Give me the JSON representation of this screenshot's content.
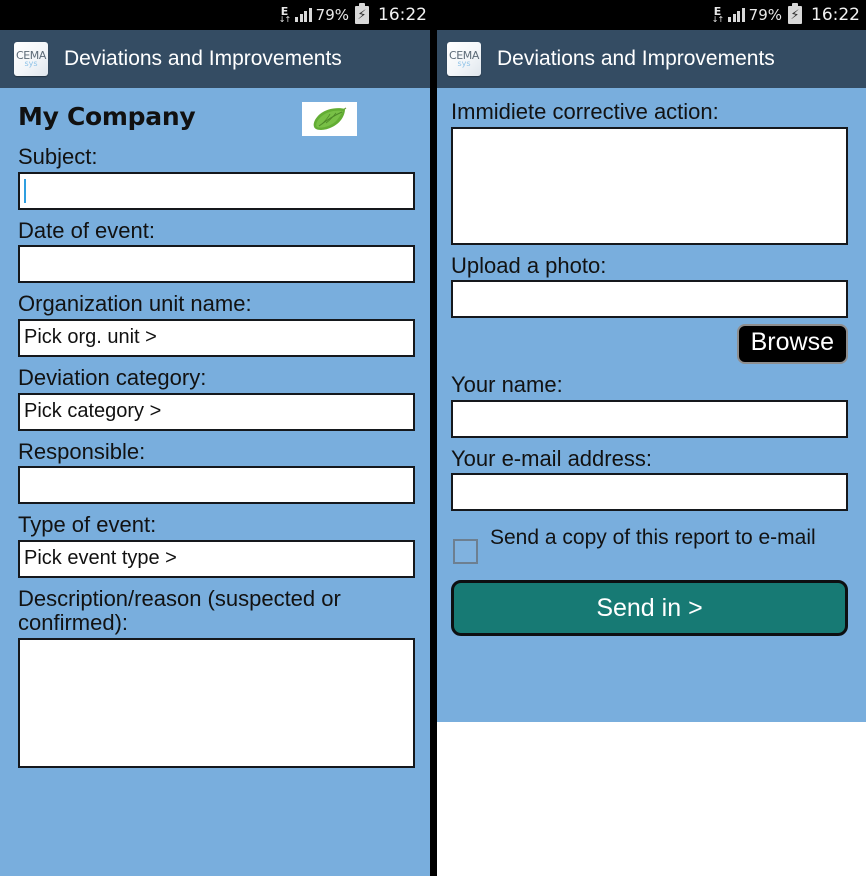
{
  "status_bar": {
    "network_label": "E",
    "network_arrows": "↓↑",
    "battery_percent": "79%",
    "battery_icon": "charging-bolt",
    "time": "16:22"
  },
  "app_header": {
    "logo_line1": "CEMA",
    "logo_line2": "sys",
    "title": "Deviations and Improvements"
  },
  "colors": {
    "status_bar_bg": "#000000",
    "app_header_bg": "#344c63",
    "form_bg": "#79aedd",
    "field_bg": "#ffffff",
    "field_border": "#15181c",
    "send_button_bg": "#177a74",
    "browse_button_bg": "#000000",
    "leaf_green": "#5aa02c"
  },
  "left_screen": {
    "company_name": "My Company",
    "logo_image": "green-leaf",
    "fields": [
      {
        "label": "Subject:",
        "value": "",
        "type": "text",
        "focused": true
      },
      {
        "label": "Date of event:",
        "value": "",
        "type": "text",
        "focused": false
      },
      {
        "label": "Organization unit name:",
        "value": "Pick org. unit >",
        "type": "picker",
        "focused": false
      },
      {
        "label": "Deviation category:",
        "value": "Pick category >",
        "type": "picker",
        "focused": false
      },
      {
        "label": "Responsible:",
        "value": "",
        "type": "text",
        "focused": false
      },
      {
        "label": "Type of event:",
        "value": "Pick event type >",
        "type": "picker",
        "focused": false
      },
      {
        "label": "Description/reason (suspected or confirmed):",
        "value": "",
        "type": "textarea",
        "focused": false
      }
    ]
  },
  "right_screen": {
    "corrective_label": "Immidiete corrective action:",
    "corrective_value": "",
    "upload_label": "Upload a photo:",
    "upload_value": "",
    "browse_label": "Browse",
    "name_label": "Your name:",
    "name_value": "",
    "email_label": "Your e-mail address:",
    "email_value": "",
    "copy_checkbox_label": "Send a copy of this report to e-mail",
    "copy_checkbox_checked": false,
    "submit_label": "Send in >"
  }
}
